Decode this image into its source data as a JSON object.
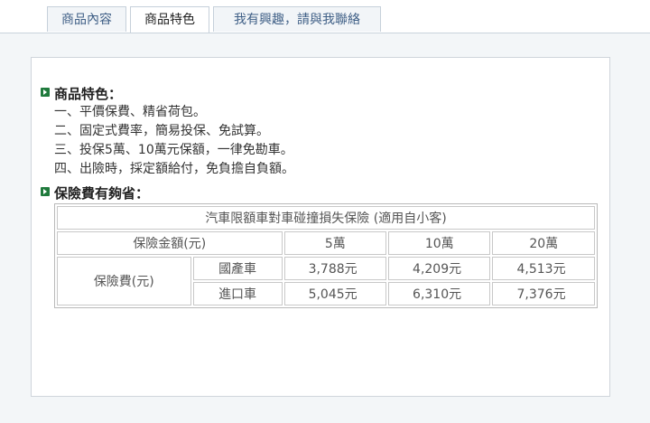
{
  "tabs": [
    {
      "label": "商品內容"
    },
    {
      "label": "商品特色"
    },
    {
      "label": "我有興趣，請與我聯絡"
    }
  ],
  "features": {
    "title": "商品特色：",
    "items": [
      "一、平價保費、精省荷包。",
      "二、固定式費率，簡易投保、免試算。",
      "三、投保5萬、10萬元保額，一律免勘車。",
      "四、出險時，採定額給付，免負擔自負額。"
    ]
  },
  "premium": {
    "title": "保險費有夠省："
  },
  "table": {
    "caption": "汽車限額車對車碰撞損失保險 (適用自小客)",
    "amount_label": "保險金額(元)",
    "amounts": [
      "5萬",
      "10萬",
      "20萬"
    ],
    "fee_label": "保險費(元)",
    "rows": [
      {
        "type": "國產車",
        "values": [
          "3,788元",
          "4,209元",
          "4,513元"
        ]
      },
      {
        "type": "進口車",
        "values": [
          "5,045元",
          "6,310元",
          "7,376元"
        ]
      }
    ]
  },
  "colors": {
    "bullet": "#1f7a3c",
    "tab_text": "#3f5f86"
  }
}
